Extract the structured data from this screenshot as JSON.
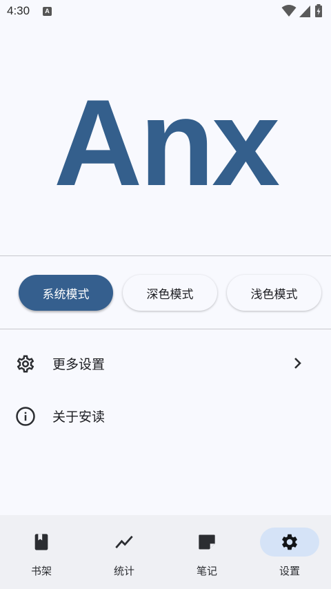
{
  "status_bar": {
    "time": "4:30",
    "notification_letter": "A"
  },
  "logo": {
    "text": "Anx",
    "color": "#345f8c"
  },
  "theme_modes": [
    {
      "label": "系统模式",
      "selected": true
    },
    {
      "label": "深色模式",
      "selected": false
    },
    {
      "label": "浅色模式",
      "selected": false
    }
  ],
  "settings_list": [
    {
      "label": "更多设置",
      "icon": "gear-icon",
      "has_chevron": true
    },
    {
      "label": "关于安读",
      "icon": "info-icon",
      "has_chevron": false
    }
  ],
  "bottom_nav": [
    {
      "label": "书架",
      "icon": "bookshelf-icon",
      "active": false
    },
    {
      "label": "统计",
      "icon": "chart-icon",
      "active": false
    },
    {
      "label": "笔记",
      "icon": "note-icon",
      "active": false
    },
    {
      "label": "设置",
      "icon": "settings-icon",
      "active": true
    }
  ],
  "colors": {
    "accent": "#355f8e",
    "background": "#f8f9fe",
    "nav_background": "#eff0f4",
    "nav_active_pill": "#d5e3f7"
  }
}
